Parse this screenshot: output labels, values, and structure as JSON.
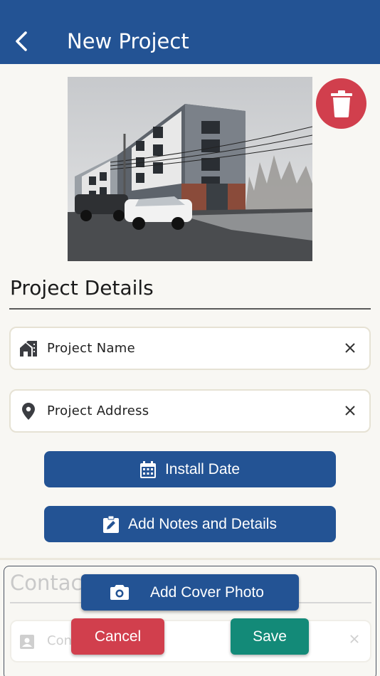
{
  "header": {
    "title": "New Project",
    "back_icon": "chevron-left-icon"
  },
  "cover_photo": {
    "alt": "Project cover photo",
    "delete_icon": "trash-icon"
  },
  "details": {
    "title": "Project Details",
    "fields": [
      {
        "icon": "home-work-icon",
        "label": "Project Name",
        "clear_icon": "close-icon"
      },
      {
        "icon": "location-pin-icon",
        "label": "Project Address",
        "clear_icon": "close-icon"
      }
    ],
    "install_date_label": "Install Date",
    "notes_label": "Add Notes and Details"
  },
  "contacts": {
    "title_partial": "Contact",
    "field_partial": "Con"
  },
  "actions": {
    "add_cover_photo": "Add Cover Photo",
    "cancel": "Cancel",
    "save": "Save"
  },
  "colors": {
    "primary": "#235394",
    "danger": "#d13f4d",
    "success": "#138a78",
    "background": "#f8f7f3"
  }
}
